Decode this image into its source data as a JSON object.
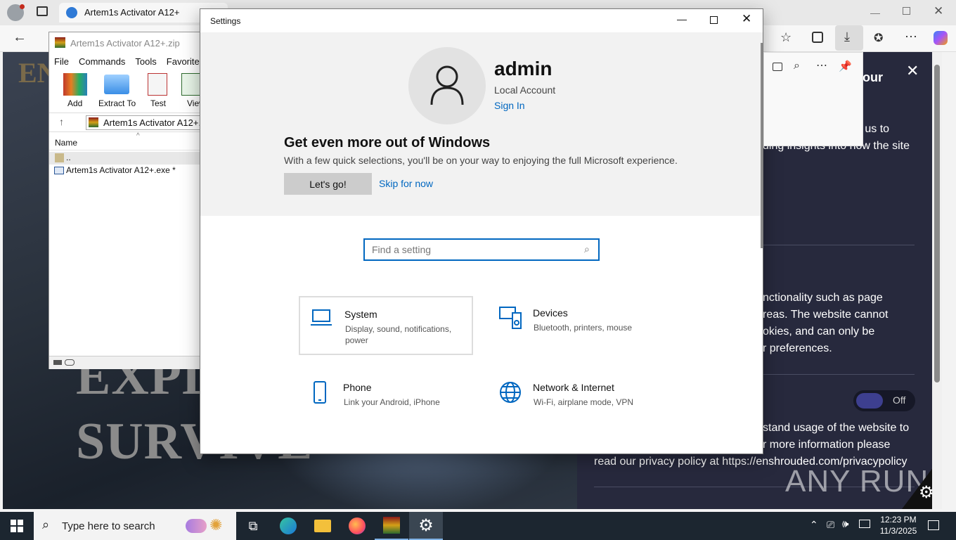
{
  "browser": {
    "tab_title": "Artem1s Activator A12+",
    "consent_heading": "your",
    "consent_p1": [
      "o us to",
      "ding insights into how the site"
    ],
    "consent_p2": [
      "nctionality such as page",
      "reas. The website cannot",
      "okies, and can only be",
      "r preferences."
    ],
    "toggle_label": "Off",
    "consent_p3": [
      "stand usage of the website to",
      "r more information please",
      "read our privacy policy at https://enshrouded.com/privacypolicy"
    ],
    "hero_lines": [
      "EXPL",
      "SURVIVE"
    ],
    "logo_text": "EN",
    "watermark": "ANY RUN"
  },
  "winrar": {
    "title": "Artem1s Activator A12+.zip",
    "menu": [
      "File",
      "Commands",
      "Tools",
      "Favorites"
    ],
    "toolbar": [
      "Add",
      "Extract To",
      "Test",
      "View"
    ],
    "path": "Artem1s Activator A12+.zi",
    "column_name": "Name",
    "rows": [
      "..",
      "Artem1s Activator A12+.exe *"
    ]
  },
  "settings": {
    "window_title": "Settings",
    "user_name": "admin",
    "account_type": "Local Account",
    "sign_in": "Sign In",
    "promo_title": "Get even more out of Windows",
    "promo_desc": "With a few quick selections, you'll be on your way to enjoying the full Microsoft experience.",
    "lets_go": "Let's go!",
    "skip": "Skip for now",
    "search_placeholder": "Find a setting",
    "categories": [
      {
        "title": "System",
        "subtitle": "Display, sound, notifications, power",
        "icon": "laptop-icon"
      },
      {
        "title": "Devices",
        "subtitle": "Bluetooth, printers, mouse",
        "icon": "devices-icon"
      },
      {
        "title": "Phone",
        "subtitle": "Link your Android, iPhone",
        "icon": "phone-icon"
      },
      {
        "title": "Network & Internet",
        "subtitle": "Wi-Fi, airplane mode, VPN",
        "icon": "globe-icon"
      }
    ]
  },
  "taskbar": {
    "search_placeholder": "Type here to search",
    "time": "12:23 PM",
    "date": "11/3/2025"
  },
  "colors": {
    "accent": "#0067c0",
    "consent_bg": "#27293d",
    "taskbar_bg": "#1c2630"
  }
}
